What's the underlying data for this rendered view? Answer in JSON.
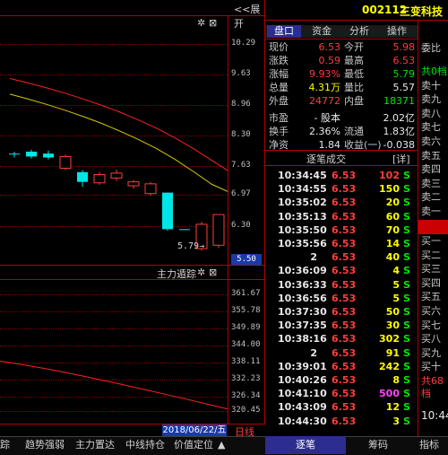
{
  "header": {
    "collapse_label": "<<展开",
    "stock_code": "002112",
    "stock_name": "三变科技",
    "right_col_top": "委比",
    "time_now": "10:44"
  },
  "tabs": [
    "盘口",
    "资金",
    "分析",
    "操作"
  ],
  "chart": {
    "price_ticks": [
      "10.29",
      "9.63",
      "8.96",
      "8.30",
      "7.63",
      "6.97",
      "6.30"
    ],
    "low_marker": "5.79",
    "current_price_tag": "5.50",
    "indicator_title": "主力遁踪",
    "indicator_ticks": [
      "361.67",
      "355.78",
      "349.89",
      "344.00",
      "338.11",
      "332.23",
      "326.34",
      "320.45"
    ],
    "date_label": "2018/06/22/五",
    "period_label": "日线"
  },
  "chart_data": {
    "type": "candlestick",
    "ylim": [
      5.5,
      10.6
    ],
    "candles": [
      {
        "o": 7.78,
        "c": 7.78,
        "h": 7.82,
        "l": 7.7
      },
      {
        "o": 7.82,
        "c": 7.72,
        "h": 7.86,
        "l": 7.68
      },
      {
        "o": 7.78,
        "c": 7.7,
        "h": 7.84,
        "l": 7.66
      },
      {
        "o": 7.48,
        "c": 7.72,
        "h": 7.76,
        "l": 7.44
      },
      {
        "o": 7.4,
        "c": 7.2,
        "h": 7.44,
        "l": 7.1
      },
      {
        "o": 7.18,
        "c": 7.35,
        "h": 7.4,
        "l": 7.14
      },
      {
        "o": 7.28,
        "c": 7.38,
        "h": 7.45,
        "l": 7.22
      },
      {
        "o": 7.12,
        "c": 7.2,
        "h": 7.24,
        "l": 7.06
      },
      {
        "o": 6.96,
        "c": 7.16,
        "h": 7.2,
        "l": 6.92
      },
      {
        "o": 6.98,
        "c": 6.23,
        "h": 6.98,
        "l": 6.2
      },
      {
        "o": 6.23,
        "c": 6.23,
        "h": 6.23,
        "l": 6.23
      },
      {
        "o": 5.83,
        "c": 6.33,
        "h": 6.38,
        "l": 5.79
      },
      {
        "o": 5.9,
        "c": 6.53,
        "h": 6.53,
        "l": 5.85
      }
    ],
    "ma_yellow": [
      9.0,
      8.9,
      8.79,
      8.67,
      8.54,
      8.4,
      8.24,
      8.07,
      7.88,
      7.66,
      7.41,
      7.15,
      6.98
    ],
    "ma_red": [
      9.32,
      9.23,
      9.13,
      9.02,
      8.9,
      8.77,
      8.63,
      8.47,
      8.3,
      8.1,
      7.88,
      7.64,
      7.4
    ],
    "indicator_line": [
      337.5,
      336.0,
      334.3,
      332.4,
      330.4,
      328.3,
      326.2,
      324.0,
      321.8
    ]
  },
  "quote": {
    "rows": [
      {
        "l1": "现价",
        "v1": "6.53",
        "c1": "red",
        "l2": "今开",
        "v2": "5.98",
        "c2": "red"
      },
      {
        "l1": "涨跌",
        "v1": "0.59",
        "c1": "red",
        "l2": "最高",
        "v2": "6.53",
        "c2": "red"
      },
      {
        "l1": "涨幅",
        "v1": "9.93%",
        "c1": "red",
        "l2": "最低",
        "v2": "5.79",
        "c2": "grn"
      },
      {
        "l1": "总量",
        "v1": "4.31万",
        "c1": "yel",
        "l2": "量比",
        "v2": "5.57",
        "c2": "wht"
      },
      {
        "l1": "外盘",
        "v1": "24772",
        "c1": "red",
        "l2": "内盘",
        "v2": "18371",
        "c2": "grn"
      },
      {
        "l1": "市盈",
        "v1": "- 股本",
        "c1": "wht",
        "l2": "",
        "v2": "2.02亿",
        "c2": "wht"
      },
      {
        "l1": "换手",
        "v1": "2.36%",
        "c1": "wht",
        "l2": "流通",
        "v2": "1.83亿",
        "c2": "wht"
      },
      {
        "l1": "净资",
        "v1": "1.84",
        "c1": "wht",
        "l2": "收益(一)",
        "v2": "-0.038",
        "c2": "wht"
      }
    ]
  },
  "trades": {
    "title": "逐笔成交",
    "detail_label": "[详]",
    "rows": [
      {
        "time": "10:34:45",
        "price": "6.53",
        "vol": "102",
        "vc": "red",
        "side": "S"
      },
      {
        "time": "10:34:55",
        "price": "6.53",
        "vol": "150",
        "vc": "yel",
        "side": "S"
      },
      {
        "time": "10:35:02",
        "price": "6.53",
        "vol": "20",
        "vc": "yel",
        "side": "S"
      },
      {
        "time": "10:35:13",
        "price": "6.53",
        "vol": "60",
        "vc": "yel",
        "side": "S"
      },
      {
        "time": "10:35:50",
        "price": "6.53",
        "vol": "70",
        "vc": "yel",
        "side": "S"
      },
      {
        "time": "10:35:56",
        "price": "6.53",
        "vol": "14",
        "vc": "yel",
        "side": "S"
      },
      {
        "time": "2",
        "price": "6.53",
        "vol": "40",
        "vc": "yel",
        "side": "S"
      },
      {
        "time": "10:36:09",
        "price": "6.53",
        "vol": "4",
        "vc": "yel",
        "side": "S"
      },
      {
        "time": "10:36:33",
        "price": "6.53",
        "vol": "5",
        "vc": "yel",
        "side": "S"
      },
      {
        "time": "10:36:56",
        "price": "6.53",
        "vol": "5",
        "vc": "yel",
        "side": "S"
      },
      {
        "time": "10:37:30",
        "price": "6.53",
        "vol": "50",
        "vc": "yel",
        "side": "S"
      },
      {
        "time": "10:37:35",
        "price": "6.53",
        "vol": "30",
        "vc": "yel",
        "side": "S"
      },
      {
        "time": "10:38:16",
        "price": "6.53",
        "vol": "302",
        "vc": "yel",
        "side": "S"
      },
      {
        "time": "2",
        "price": "6.53",
        "vol": "91",
        "vc": "yel",
        "side": "S"
      },
      {
        "time": "10:39:01",
        "price": "6.53",
        "vol": "242",
        "vc": "yel",
        "side": "S"
      },
      {
        "time": "10:40:26",
        "price": "6.53",
        "vol": "8",
        "vc": "yel",
        "side": "S"
      },
      {
        "time": "10:41:10",
        "price": "6.53",
        "vol": "500",
        "vc": "mag",
        "side": "S"
      },
      {
        "time": "10:43:09",
        "price": "6.53",
        "vol": "12",
        "vc": "yel",
        "side": "S"
      },
      {
        "time": "10:44:30",
        "price": "6.53",
        "vol": "3",
        "vc": "yel",
        "side": "S"
      }
    ]
  },
  "orderbook": {
    "sell": [
      "共0档",
      "卖十",
      "卖九",
      "卖八",
      "卖七",
      "卖六",
      "卖五",
      "卖四",
      "卖三",
      "卖二",
      "卖一"
    ],
    "buy": [
      "买一",
      "买二",
      "买三",
      "买四",
      "买五",
      "买六",
      "买七",
      "买八",
      "买九",
      "买十",
      "共68档"
    ]
  },
  "bottom_bar": {
    "left_tabs": [
      "踪",
      "趋势强弱",
      "主力置达",
      "中线持仓",
      "价值定位"
    ],
    "right_tabs": [
      "逐笔",
      "筹码",
      "指标"
    ]
  },
  "colors": {
    "rise": "#ff3c3c",
    "fall": "#00e6e6",
    "ma_yellow": "#d8c800",
    "ma_red": "#ff2020",
    "tab_active": "#2d2d8f"
  }
}
